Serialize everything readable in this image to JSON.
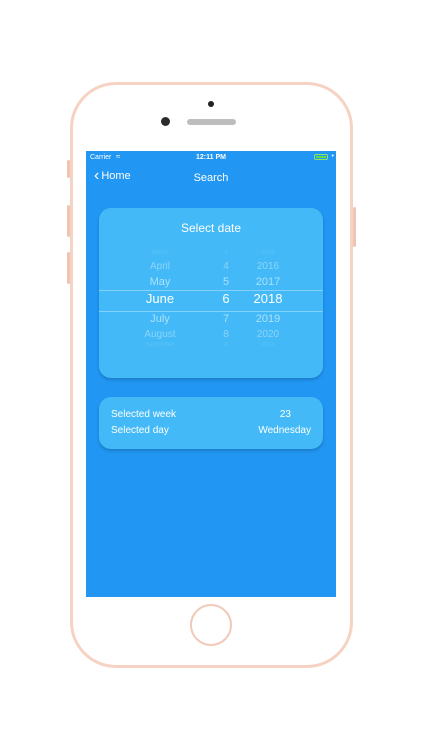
{
  "status": {
    "carrier": "Carrier",
    "time": "12:11 PM"
  },
  "nav": {
    "back_label": "Home",
    "title": "Search"
  },
  "picker": {
    "title": "Select date",
    "months": [
      "March",
      "April",
      "May",
      "June",
      "July",
      "August",
      "September"
    ],
    "days": [
      "3",
      "4",
      "5",
      "6",
      "7",
      "8",
      "9"
    ],
    "years": [
      "2015",
      "2016",
      "2017",
      "2018",
      "2019",
      "2020",
      "2021"
    ],
    "selected_index": 3
  },
  "info": {
    "week_label": "Selected week",
    "week_value": "23",
    "day_label": "Selected day",
    "day_value": "Wednesday"
  },
  "colors": {
    "screen_bg": "#2196f3",
    "card_bg": "#43baf7",
    "phone_frame": "#f6d2c3"
  }
}
